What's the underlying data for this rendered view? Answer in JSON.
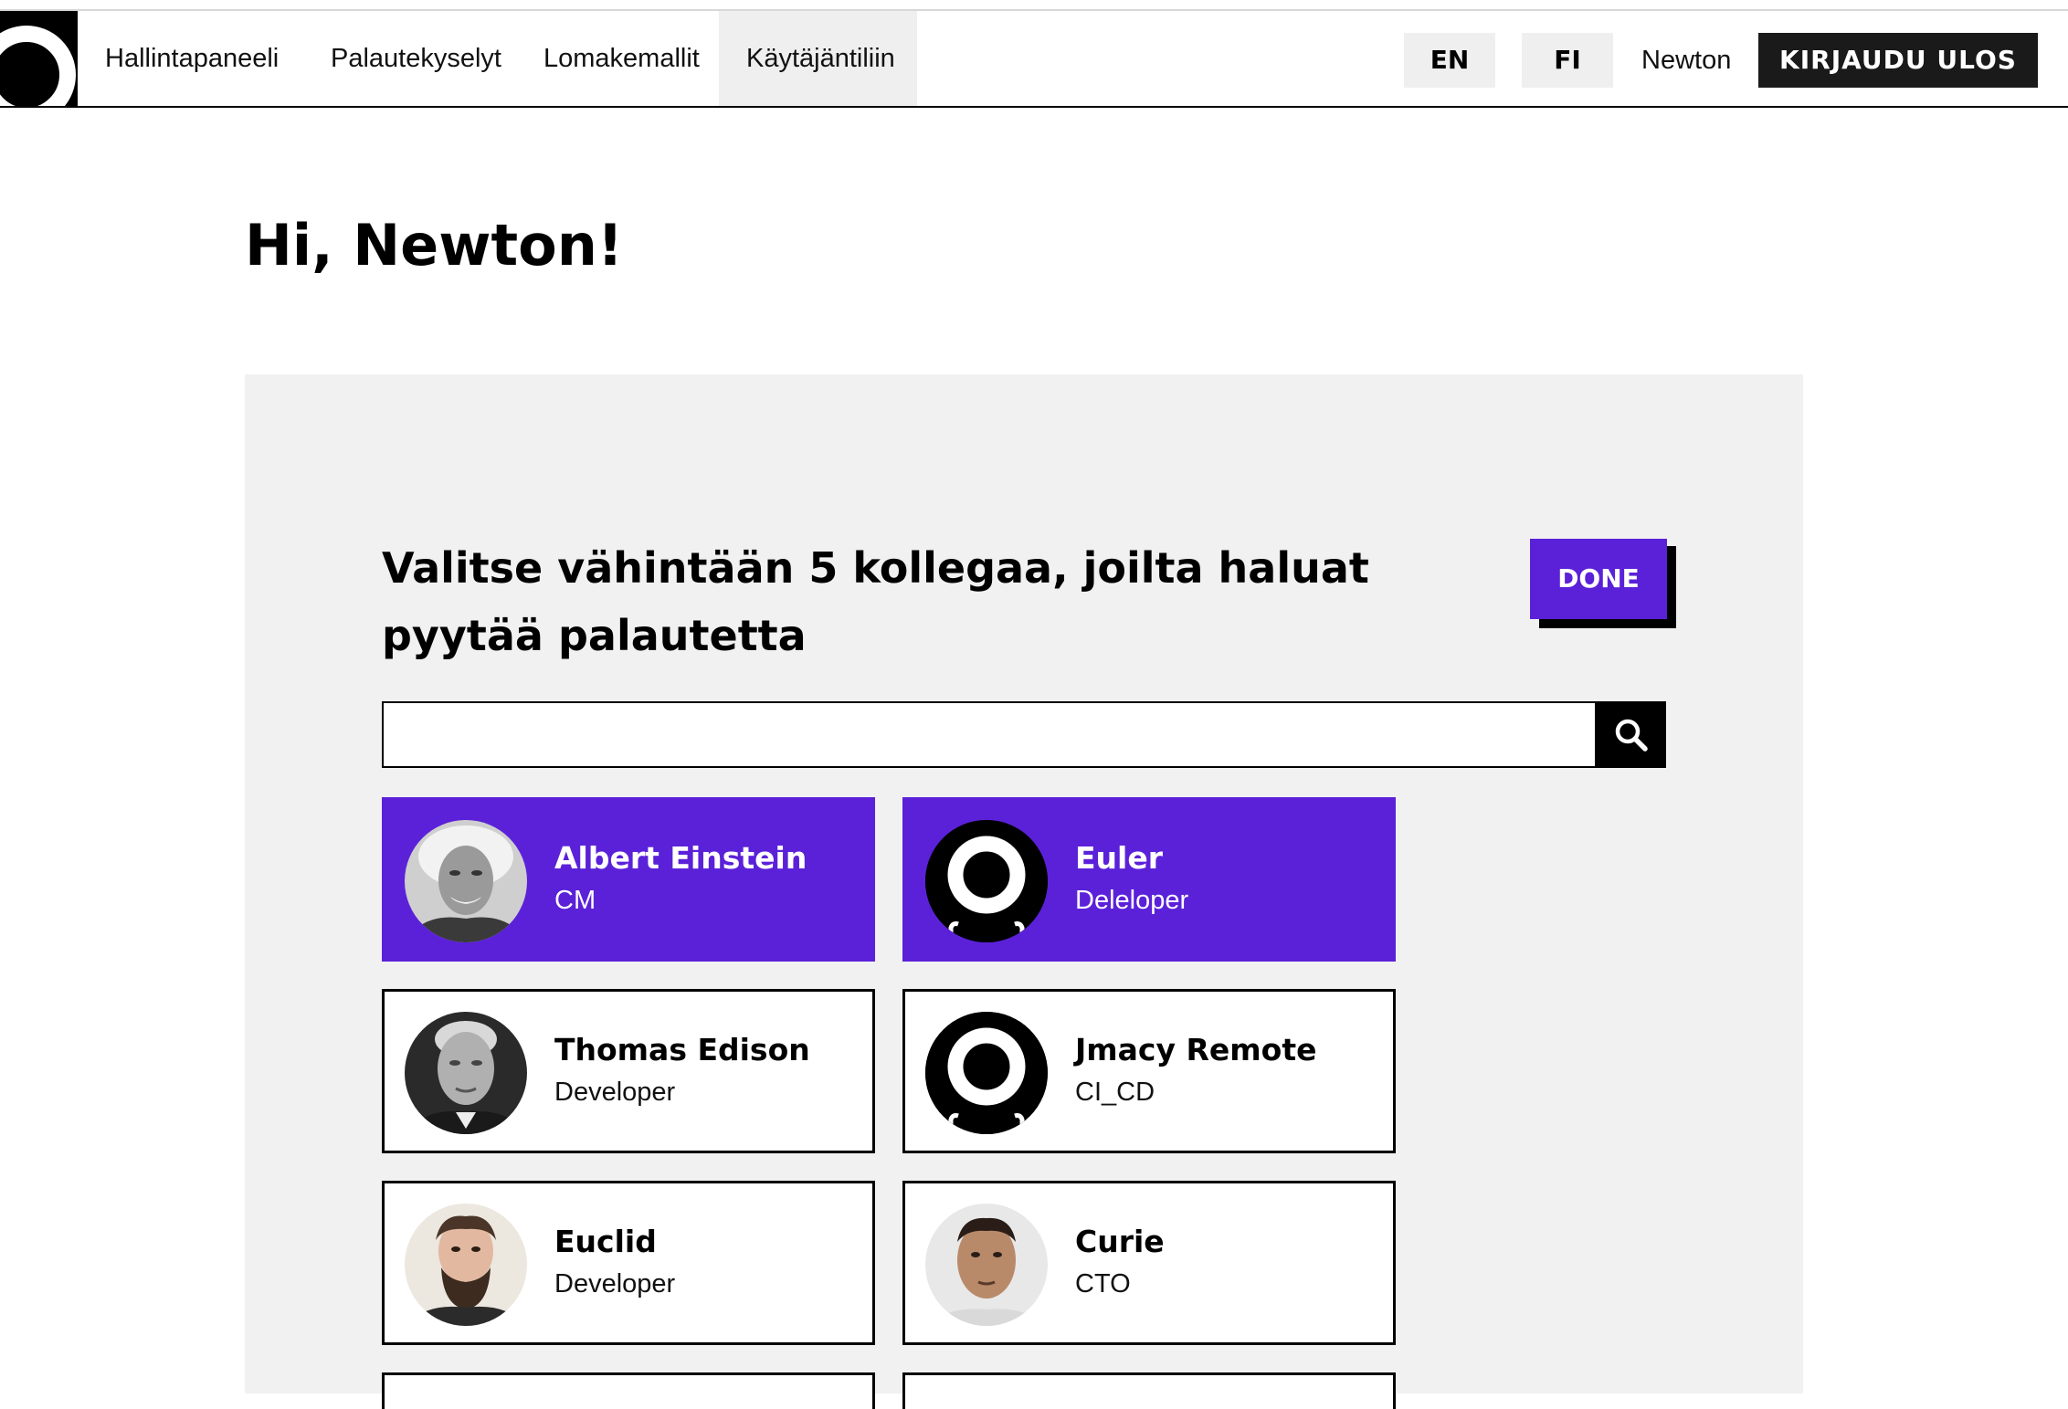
{
  "nav": {
    "items": [
      {
        "label": "Hallintapaneeli"
      },
      {
        "label": "Palautekyselyt"
      },
      {
        "label": "Lomakemallit"
      },
      {
        "label": "Käytäjäntiliin"
      }
    ],
    "lang_en": "EN",
    "lang_fi": "FI",
    "user_name": "Newton",
    "logout_label": "KIRJAUDU ULOS"
  },
  "page": {
    "greeting": "Hi, Newton!",
    "instruction": "Valitse vähintään 5 kollegaa, joilta haluat pyytää palautetta",
    "done_label": "DONE",
    "search": {
      "value": "",
      "placeholder": ""
    }
  },
  "colleagues": [
    {
      "name": "Albert Einstein",
      "role": "CM",
      "selected": true
    },
    {
      "name": "Euler",
      "role": "Deleloper",
      "selected": true
    },
    {
      "name": "Thomas Edison",
      "role": "Developer",
      "selected": false
    },
    {
      "name": "Jmacy Remote",
      "role": "CI_CD",
      "selected": false
    },
    {
      "name": "Euclid",
      "role": "Developer",
      "selected": false
    },
    {
      "name": "Curie",
      "role": "CTO",
      "selected": false
    }
  ],
  "colors": {
    "accent": "#5b21d9",
    "dark": "#1a1a1a",
    "panel": "#f1f1f1"
  }
}
